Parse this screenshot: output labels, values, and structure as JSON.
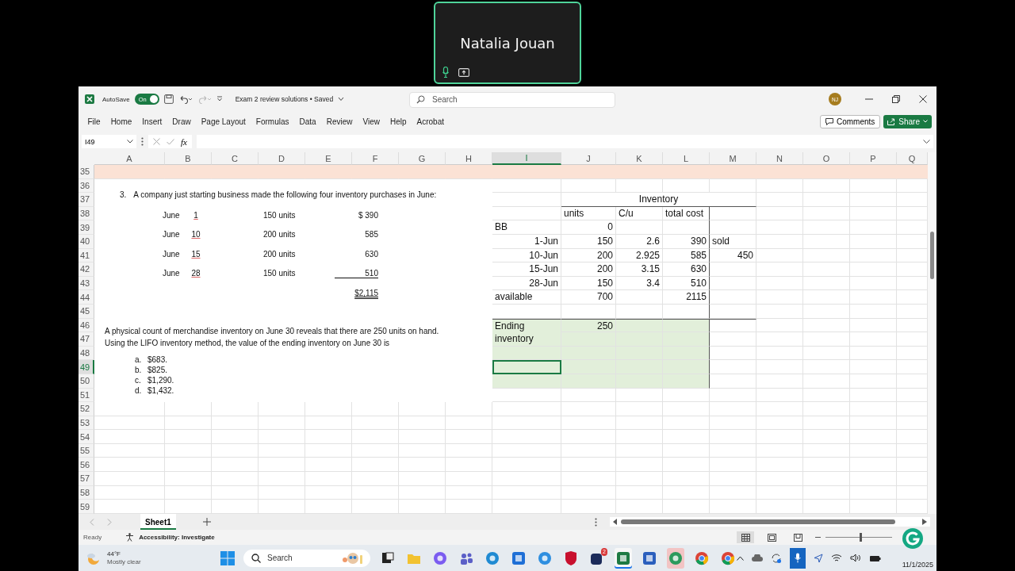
{
  "meeting": {
    "participant": "Natalia Jouan"
  },
  "window": {
    "autosave": {
      "label": "AutoSave",
      "on": true,
      "state": "On"
    },
    "document_title": "Exam 2 review solutions • Saved",
    "search": {
      "placeholder": "Search"
    },
    "avatar": "NJ",
    "ribbon_tabs": [
      {
        "label": "File",
        "selected": false
      },
      {
        "label": "Home",
        "selected": false
      },
      {
        "label": "Insert",
        "selected": false
      },
      {
        "label": "Draw",
        "selected": false
      },
      {
        "label": "Page Layout",
        "selected": false
      },
      {
        "label": "Formulas",
        "selected": false
      },
      {
        "label": "Data",
        "selected": false
      },
      {
        "label": "Review",
        "selected": false
      },
      {
        "label": "View",
        "selected": false
      },
      {
        "label": "Help",
        "selected": false
      },
      {
        "label": "Acrobat",
        "selected": false
      }
    ],
    "comments_button": "Comments",
    "share_button": "Share",
    "name_box": "I49",
    "function_label": "fx"
  },
  "sheet": {
    "columns": [
      {
        "label": "A",
        "selected": false
      },
      {
        "label": "B",
        "selected": false
      },
      {
        "label": "C",
        "selected": false
      },
      {
        "label": "D",
        "selected": false
      },
      {
        "label": "E",
        "selected": false
      },
      {
        "label": "F",
        "selected": false
      },
      {
        "label": "G",
        "selected": false
      },
      {
        "label": "H",
        "selected": false
      },
      {
        "label": "I",
        "selected": true
      },
      {
        "label": "J",
        "selected": false
      },
      {
        "label": "K",
        "selected": false
      },
      {
        "label": "L",
        "selected": false
      },
      {
        "label": "M",
        "selected": false
      },
      {
        "label": "N",
        "selected": false
      },
      {
        "label": "O",
        "selected": false
      },
      {
        "label": "P",
        "selected": false
      },
      {
        "label": "Q",
        "selected": false
      }
    ],
    "row_numbers": [
      {
        "label": "35",
        "selected": false
      },
      {
        "label": "36",
        "selected": false
      },
      {
        "label": "37",
        "selected": false
      },
      {
        "label": "38",
        "selected": false
      },
      {
        "label": "39",
        "selected": false
      },
      {
        "label": "40",
        "selected": false
      },
      {
        "label": "41",
        "selected": false
      },
      {
        "label": "42",
        "selected": false
      },
      {
        "label": "43",
        "selected": false
      },
      {
        "label": "44",
        "selected": false
      },
      {
        "label": "45",
        "selected": false
      },
      {
        "label": "46",
        "selected": false
      },
      {
        "label": "47",
        "selected": false
      },
      {
        "label": "48",
        "selected": false
      },
      {
        "label": "49",
        "selected": true
      },
      {
        "label": "50",
        "selected": false
      },
      {
        "label": "51",
        "selected": false
      },
      {
        "label": "52",
        "selected": false
      },
      {
        "label": "53",
        "selected": false
      },
      {
        "label": "54",
        "selected": false
      },
      {
        "label": "55",
        "selected": false
      },
      {
        "label": "56",
        "selected": false
      },
      {
        "label": "57",
        "selected": false
      },
      {
        "label": "58",
        "selected": false
      },
      {
        "label": "59",
        "selected": false
      }
    ],
    "question": {
      "number": "3.",
      "intro": "A company just starting business made the following four inventory purchases in June:",
      "purchases": [
        {
          "month": "June",
          "day": "1",
          "units": "150 units",
          "cost": "$ 390",
          "underlined": false
        },
        {
          "month": "June",
          "day": "10",
          "units": "200 units",
          "cost": "585",
          "underlined": false
        },
        {
          "month": "June",
          "day": "15",
          "units": "200 units",
          "cost": "630",
          "underlined": false
        },
        {
          "month": "June",
          "day": "28",
          "units": "150 units",
          "cost": "510",
          "underlined": true
        }
      ],
      "total": "$2,115",
      "sentences": [
        "A physical count of merchandise inventory on June 30 reveals that there are 250 units on hand.",
        "Using the LIFO inventory method, the value of the ending inventory on June 30 is"
      ],
      "options": [
        {
          "letter": "a.",
          "value": "$683."
        },
        {
          "letter": "b.",
          "value": "$825."
        },
        {
          "letter": "c.",
          "value": "$1,290."
        },
        {
          "letter": "d.",
          "value": "$1,432."
        }
      ]
    },
    "inventory": {
      "title": "Inventory",
      "headers": [
        "units",
        "C/u",
        "total cost"
      ],
      "rows": [
        {
          "label": "BB",
          "kind": "text",
          "units": "0"
        },
        {
          "label": "1-Jun",
          "kind": "date",
          "units": "150",
          "cost_per_unit": "2.6",
          "total_cost": "390",
          "column_m": {
            "text": "sold",
            "kind": "text"
          }
        },
        {
          "label": "10-Jun",
          "kind": "date",
          "units": "200",
          "cost_per_unit": "2.925",
          "total_cost": "585",
          "column_m": {
            "text": "450",
            "kind": "number"
          }
        },
        {
          "label": "15-Jun",
          "kind": "date",
          "units": "200",
          "cost_per_unit": "3.15",
          "total_cost": "630"
        },
        {
          "label": "28-Jun",
          "kind": "date",
          "units": "150",
          "cost_per_unit": "3.4",
          "total_cost": "510"
        },
        {
          "label": "available",
          "kind": "text",
          "units": "700",
          "total_cost": "2115"
        }
      ],
      "ending": {
        "label": "Ending inventory",
        "units": "250"
      }
    }
  },
  "sheet_tabs": [
    {
      "label": "Sheet1",
      "selected": true
    }
  ],
  "status_bar": {
    "mode": "Ready",
    "accessibility": "Accessibility: Investigate",
    "views": [
      {
        "selected": true
      },
      {
        "selected": false
      },
      {
        "selected": false
      }
    ],
    "zoom_slider": {
      "level": 0.52
    }
  },
  "taskbar": {
    "weather": {
      "temperature": "44°F",
      "condition": "Mostly clear"
    },
    "search": {
      "placeholder": "Search"
    },
    "app_badge": "2",
    "date": "11/1/2025"
  }
}
